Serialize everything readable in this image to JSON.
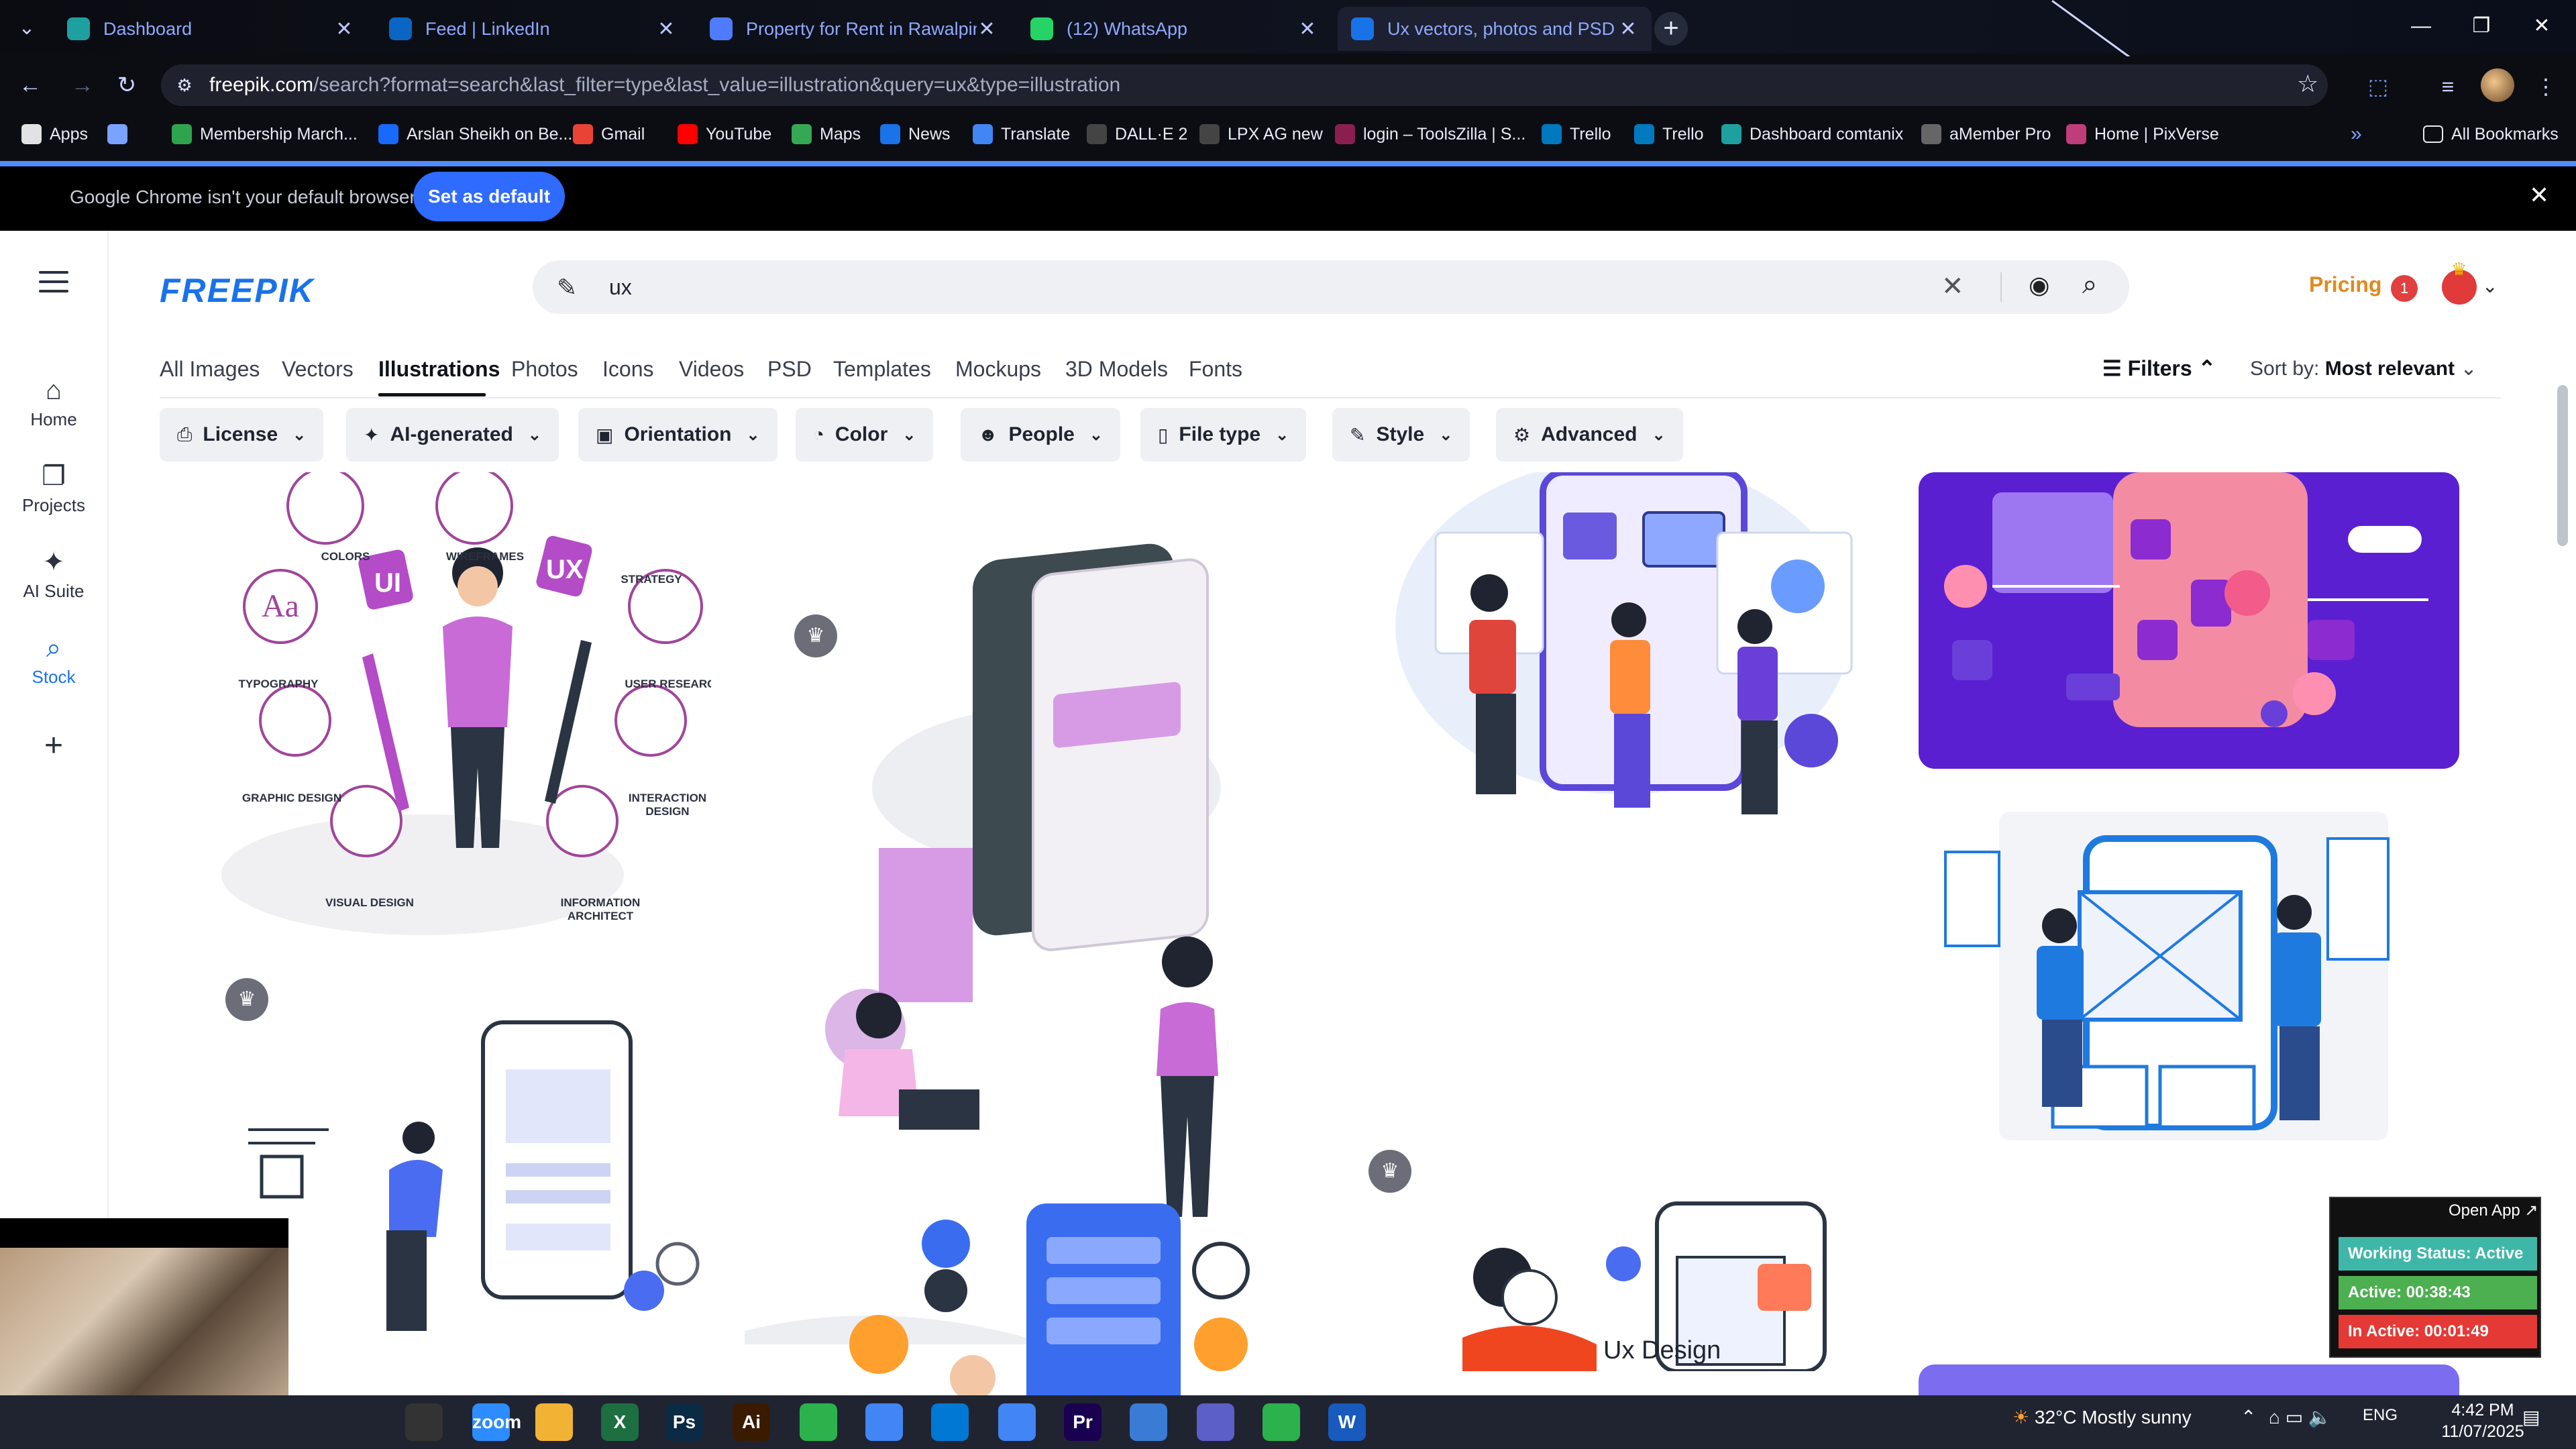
{
  "browser": {
    "tabs": [
      {
        "title": "Dashboard",
        "icon": "dashboard-icon",
        "color": "#1ea0a0"
      },
      {
        "title": "Feed | LinkedIn",
        "icon": "linkedin-icon",
        "color": "#0a66c2"
      },
      {
        "title": "Property for Rent in Rawalpindi",
        "icon": "property-icon",
        "color": "#4f7cff"
      },
      {
        "title": "(12) WhatsApp",
        "icon": "whatsapp-icon",
        "color": "#25d366"
      },
      {
        "title": "Ux vectors, photos and PSD files",
        "icon": "freepik-icon",
        "color": "#1973e8"
      }
    ],
    "url_domain": "freepik.com",
    "url_path": "/search?format=search&last_filter=type&last_value=illustration&query=ux&type=illustration",
    "bookmarks": [
      {
        "label": "Apps",
        "icon": "apps-grid-icon",
        "color": "#e2e2e2"
      },
      {
        "label": "",
        "icon": "tab-groups-icon",
        "color": "#7aa2ff"
      },
      {
        "label": "Membership March...",
        "icon": "bookmark-green-icon",
        "color": "#2ea44f"
      },
      {
        "label": "Arslan Sheikh on Be...",
        "icon": "behance-icon",
        "color": "#1769ff"
      },
      {
        "label": "Gmail",
        "icon": "gmail-icon",
        "color": "#ea4335"
      },
      {
        "label": "YouTube",
        "icon": "youtube-icon",
        "color": "#ff0000"
      },
      {
        "label": "Maps",
        "icon": "maps-icon",
        "color": "#34a853"
      },
      {
        "label": "News",
        "icon": "news-icon",
        "color": "#1a73e8"
      },
      {
        "label": "Translate",
        "icon": "translate-icon",
        "color": "#4285f4"
      },
      {
        "label": "DALL·E 2",
        "icon": "openai-icon",
        "color": "#444"
      },
      {
        "label": "LPX AG new",
        "icon": "dots-icon",
        "color": "#444"
      },
      {
        "label": "login – ToolsZilla | S...",
        "icon": "toolszilla-icon",
        "color": "#8a1f4f"
      },
      {
        "label": "Trello",
        "icon": "trello-icon",
        "color": "#0079bf"
      },
      {
        "label": "Trello",
        "icon": "trello-icon",
        "color": "#0079bf"
      },
      {
        "label": "Dashboard comtanix",
        "icon": "dashboard-icon",
        "color": "#1ea0a0"
      },
      {
        "label": "aMember Pro",
        "icon": "amember-icon",
        "color": "#666"
      },
      {
        "label": "Home | PixVerse",
        "icon": "pixverse-icon",
        "color": "#c13d7a"
      }
    ],
    "more_bookmarks": "»",
    "all_bookmarks": "All Bookmarks"
  },
  "infobar": {
    "message": "Google Chrome isn't your default browser",
    "button": "Set as default"
  },
  "site": {
    "logo": "FREEPIK",
    "search_value": "ux",
    "pricing": "Pricing",
    "notifications": "1",
    "rail": [
      {
        "label": "Home",
        "icon": "home-icon"
      },
      {
        "label": "Projects",
        "icon": "projects-icon"
      },
      {
        "label": "AI Suite",
        "icon": "ai-suite-icon"
      },
      {
        "label": "Stock",
        "icon": "stock-icon"
      }
    ],
    "categories": [
      "All Images",
      "Vectors",
      "Illustrations",
      "Photos",
      "Icons",
      "Videos",
      "PSD",
      "Templates",
      "Mockups",
      "3D Models",
      "Fonts"
    ],
    "active_category": "Illustrations",
    "filters_label": "Filters",
    "sort_label": "Sort by:",
    "sort_value": "Most relevant",
    "chips": [
      {
        "label": "License",
        "icon": "license-icon"
      },
      {
        "label": "AI-generated",
        "icon": "ai-icon"
      },
      {
        "label": "Orientation",
        "icon": "orientation-icon"
      },
      {
        "label": "Color",
        "icon": "palette-icon"
      },
      {
        "label": "People",
        "icon": "people-icon"
      },
      {
        "label": "File type",
        "icon": "file-icon"
      },
      {
        "label": "Style",
        "icon": "brush-icon"
      },
      {
        "label": "Advanced",
        "icon": "settings-icon"
      }
    ],
    "ux_wheel_labels": [
      "COLORS",
      "WIREFRAMES",
      "STRATEGY",
      "TYPOGRAPHY",
      "USER RESEARCH",
      "GRAPHIC DESIGN",
      "INTERACTION DESIGN",
      "VISUAL DESIGN",
      "INFORMATION ARCHITECT"
    ],
    "card_caption": "Ux Design"
  },
  "tracker": {
    "open_app": "Open App ↗",
    "status": "Working Status: Active",
    "active": "Active: 00:38:43",
    "inactive": "In Active: 00:01:49",
    "colors": {
      "status": "#3fb7a8",
      "active": "#4caf50",
      "inactive": "#e53935"
    }
  },
  "taskbar": {
    "weather": "32°C  Mostly sunny",
    "lang": "ENG",
    "time": "4:42 PM",
    "date": "11/07/2025",
    "apps": [
      {
        "label": "",
        "icon": "pen-icon",
        "color": "#202431"
      },
      {
        "label": "",
        "icon": "terminal-icon",
        "color": "#333"
      },
      {
        "label": "zoom",
        "icon": "zoom-icon",
        "color": "#2d8cff"
      },
      {
        "label": "",
        "icon": "folder-icon",
        "color": "#f2b233"
      },
      {
        "label": "X",
        "icon": "excel-icon",
        "color": "#1d6f42"
      },
      {
        "label": "Ps",
        "icon": "photoshop-icon",
        "color": "#0b2a44"
      },
      {
        "label": "Ai",
        "icon": "illustrator-icon",
        "color": "#3a1a00"
      },
      {
        "label": "",
        "icon": "phone-icon",
        "color": "#2bb24c"
      },
      {
        "label": "",
        "icon": "chrome-icon",
        "color": "#4285f4"
      },
      {
        "label": "",
        "icon": "vscode-icon",
        "color": "#0078d4"
      },
      {
        "label": "",
        "icon": "chrome-active-icon",
        "color": "#4285f4"
      },
      {
        "label": "Pr",
        "icon": "premiere-icon",
        "color": "#1a0050"
      },
      {
        "label": "",
        "icon": "app-diamond-icon",
        "color": "#3a7bd5"
      },
      {
        "label": "",
        "icon": "teams-icon",
        "color": "#5b5fc7"
      },
      {
        "label": "",
        "icon": "phone-icon",
        "color": "#2bb24c"
      },
      {
        "label": "W",
        "icon": "word-icon",
        "color": "#185abd"
      }
    ]
  }
}
